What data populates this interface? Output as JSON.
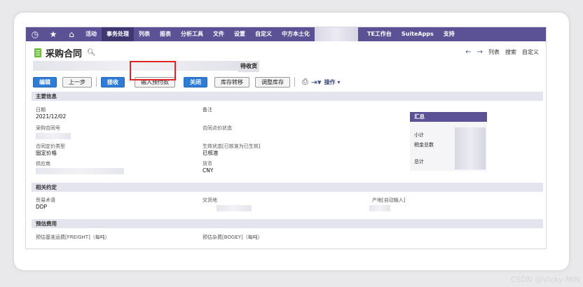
{
  "nav": {
    "items": [
      "活动",
      "事务处理",
      "列表",
      "报表",
      "分析工具",
      "文件",
      "设置",
      "自定义",
      "中方本土化"
    ],
    "items_right": [
      "TE工作台",
      "SuiteApps",
      "支持"
    ],
    "active": "事务处理"
  },
  "page": {
    "title": "采购合同",
    "status": "待收货"
  },
  "right_nav": {
    "list": "列表",
    "search": "搜索",
    "customize": "自定义"
  },
  "toolbar": {
    "edit": "编辑",
    "prev": "上一步",
    "receive": "接收",
    "prepay": "输入预付款",
    "close": "关闭",
    "transfer": "库存转移",
    "adjust": "调整库存",
    "actions": "操作"
  },
  "sections": {
    "main": "主要信息",
    "terms": "相关约定",
    "estimate": "预估费用"
  },
  "fields": {
    "date_label": "日期",
    "date_value": "2021/12/02",
    "contract_no_label": "采购合同号",
    "pricing_type_label": "合同定价类型",
    "pricing_type_value": "固定价格",
    "vendor_label": "供应商",
    "memo_label": "备注",
    "pricing_status_label": "合同点价状态",
    "effective_label": "生效状态[已核准为已生效]",
    "effective_value": "已核准",
    "currency_label": "货币",
    "currency_value": "CNY",
    "trade_term_label": "贸易术语",
    "trade_term_value": "DDP",
    "delivery_label": "交货地",
    "origin_label": "产地[自动输入]",
    "freight_label": "预估基准运费[FREIGHT]（每吨）",
    "bogey_label": "预估杂费[BOGEY]（每吨）"
  },
  "summary": {
    "title": "汇总",
    "subtotal": "小计",
    "tax_total": "税金总数",
    "total": "总计"
  },
  "watermark": "CSDN @Vicky-MIN",
  "colors": {
    "nav": "#5b5296",
    "primary_button": "#2f7cd6",
    "highlight": "#e02424"
  }
}
